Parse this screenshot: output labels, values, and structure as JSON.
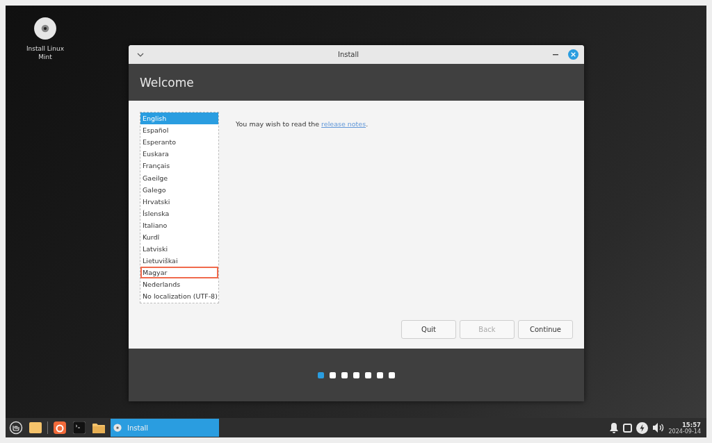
{
  "desktop_icons": [
    {
      "label": "Install Linux Mint"
    }
  ],
  "window": {
    "title": "Install",
    "header": "Welcome",
    "languages": [
      {
        "label": "English",
        "selected": true,
        "highlighted": false
      },
      {
        "label": "Español",
        "selected": false,
        "highlighted": false
      },
      {
        "label": "Esperanto",
        "selected": false,
        "highlighted": false
      },
      {
        "label": "Euskara",
        "selected": false,
        "highlighted": false
      },
      {
        "label": "Français",
        "selected": false,
        "highlighted": false
      },
      {
        "label": "Gaeilge",
        "selected": false,
        "highlighted": false
      },
      {
        "label": "Galego",
        "selected": false,
        "highlighted": false
      },
      {
        "label": "Hrvatski",
        "selected": false,
        "highlighted": false
      },
      {
        "label": "Íslenska",
        "selected": false,
        "highlighted": false
      },
      {
        "label": "Italiano",
        "selected": false,
        "highlighted": false
      },
      {
        "label": "Kurdî",
        "selected": false,
        "highlighted": false
      },
      {
        "label": "Latviski",
        "selected": false,
        "highlighted": false
      },
      {
        "label": "Lietuviškai",
        "selected": false,
        "highlighted": false
      },
      {
        "label": "Magyar",
        "selected": false,
        "highlighted": true
      },
      {
        "label": "Nederlands",
        "selected": false,
        "highlighted": false
      },
      {
        "label": "No localization (UTF-8)",
        "selected": false,
        "highlighted": false
      }
    ],
    "intro": "You may wish to read the",
    "link": "release notes",
    "intro_end": ".",
    "buttons": [
      {
        "label": "Quit",
        "disabled": false
      },
      {
        "label": "Back",
        "disabled": true
      },
      {
        "label": "Continue",
        "disabled": false
      }
    ],
    "steps": [
      {
        "selected": true
      },
      {
        "selected": false
      },
      {
        "selected": false
      },
      {
        "selected": false
      },
      {
        "selected": false
      },
      {
        "selected": false
      },
      {
        "selected": false
      }
    ]
  },
  "taskbar": {
    "window_buttons": [
      {
        "label": "Install",
        "selected": true
      }
    ],
    "clock": {
      "time": "15:57",
      "date": "2024-09-14"
    }
  }
}
